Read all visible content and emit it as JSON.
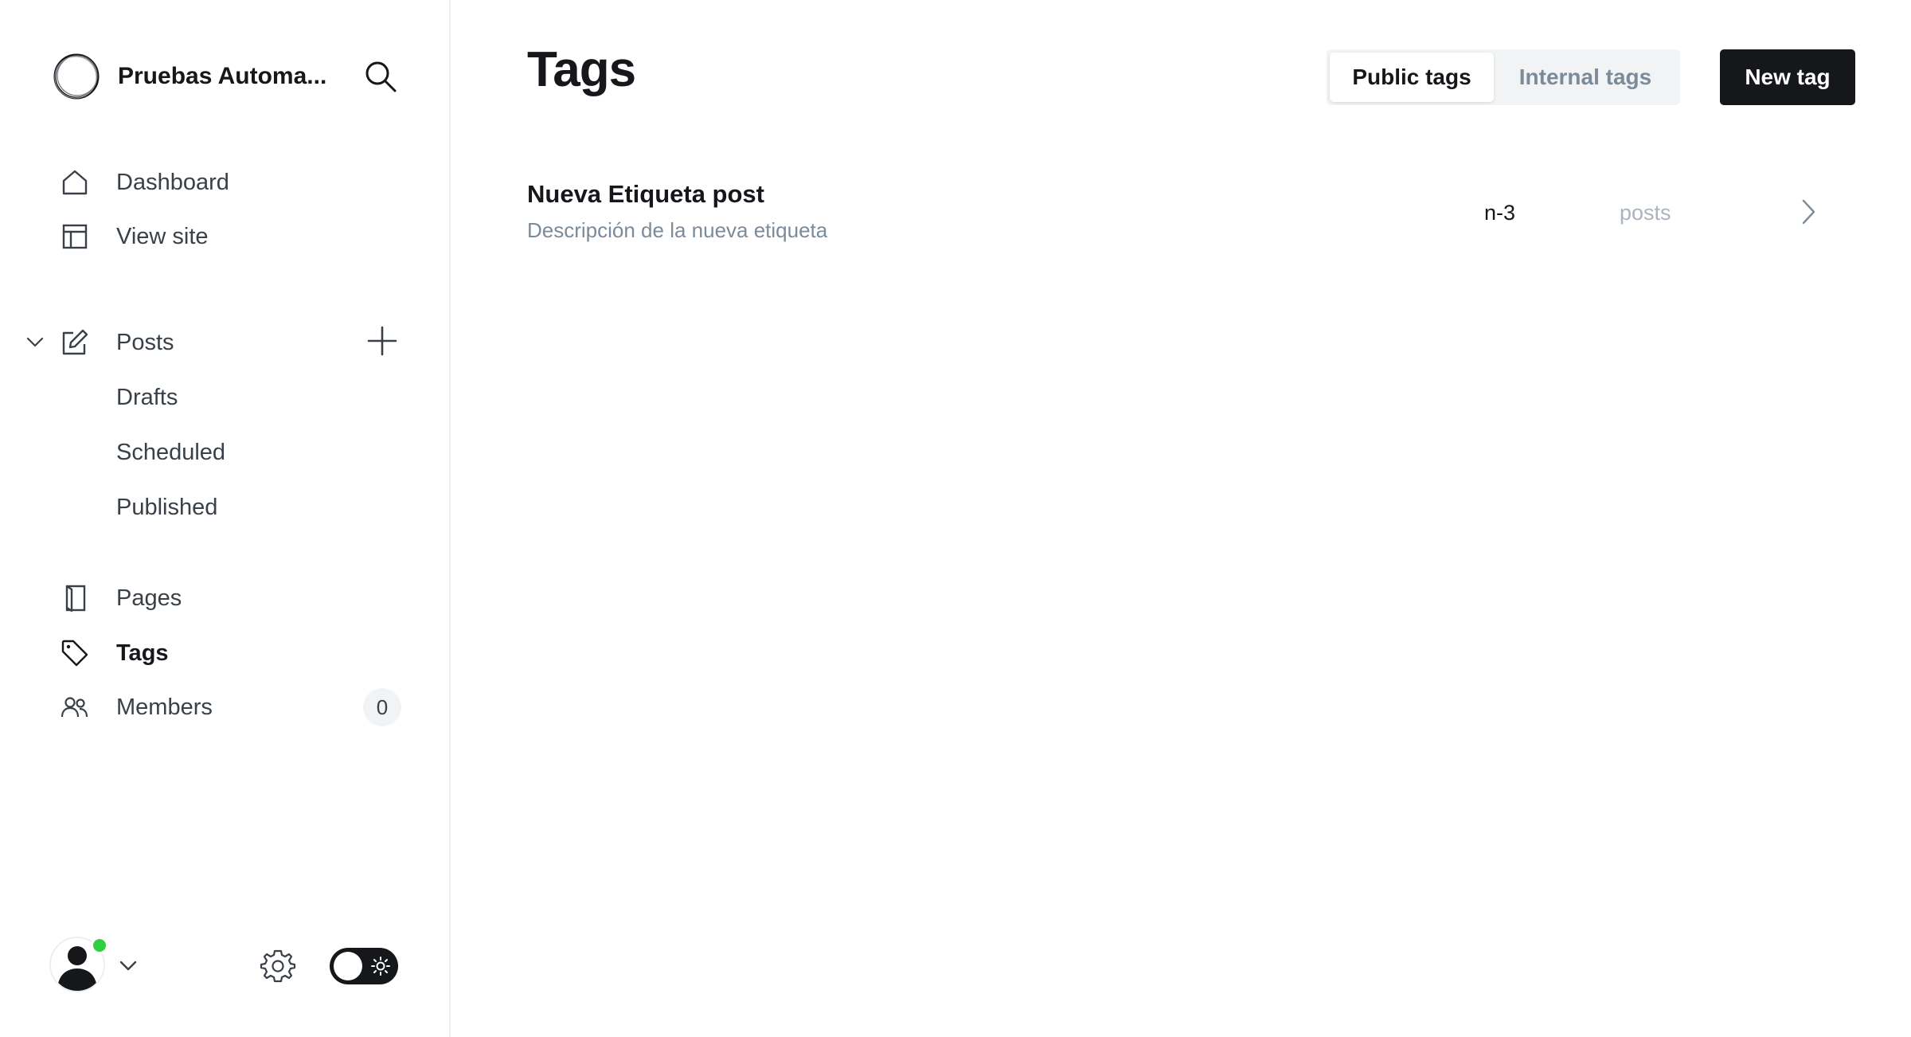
{
  "sidebar": {
    "site_title": "Pruebas Automa...",
    "nav_primary": [
      {
        "label": "Dashboard",
        "icon": "home-icon"
      },
      {
        "label": "View site",
        "icon": "view-site-icon"
      }
    ],
    "posts": {
      "label": "Posts",
      "icon": "edit-icon",
      "subitems": [
        {
          "label": "Drafts"
        },
        {
          "label": "Scheduled"
        },
        {
          "label": "Published"
        }
      ]
    },
    "nav_secondary": [
      {
        "label": "Pages",
        "icon": "page-icon"
      },
      {
        "label": "Tags",
        "icon": "tag-icon",
        "active": true
      },
      {
        "label": "Members",
        "icon": "members-icon",
        "count": "0"
      }
    ]
  },
  "header": {
    "title": "Tags",
    "tabs": [
      {
        "label": "Public tags",
        "active": true
      },
      {
        "label": "Internal tags",
        "active": false
      }
    ],
    "new_button": "New tag"
  },
  "tags": [
    {
      "name": "Nueva Etiqueta post",
      "description": "Descripción de la nueva etiqueta",
      "slug": "n-3",
      "posts_label": "posts"
    }
  ],
  "colors": {
    "accent_dark": "#15171a",
    "online": "#30cf43",
    "muted": "#7c8b9a"
  }
}
